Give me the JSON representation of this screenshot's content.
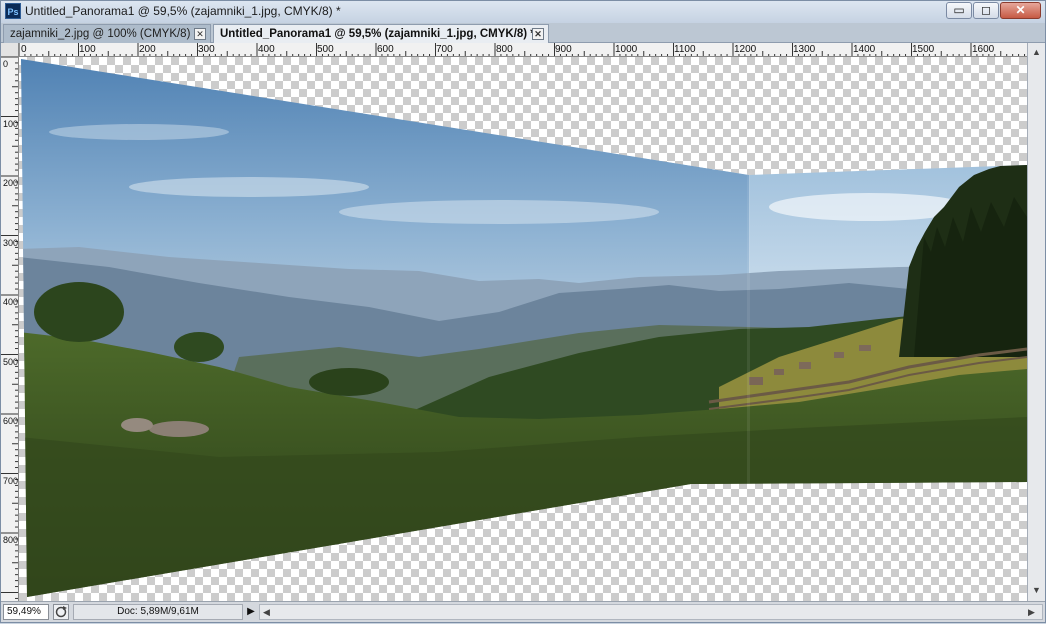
{
  "app": {
    "logo_text": "Ps",
    "window_title": "Untitled_Panorama1 @ 59,5% (zajamniki_1.jpg, CMYK/8) *"
  },
  "window_controls": {
    "minimize_icon": "minimize-icon",
    "maximize_icon": "maximize-icon",
    "close_icon": "close-icon",
    "minimize_glyph": "▭",
    "maximize_glyph": "◻",
    "close_glyph": "✕"
  },
  "tabs": [
    {
      "label": "zajamniki_2.jpg @ 100% (CMYK/8)",
      "close_glyph": "✕",
      "active": false
    },
    {
      "label": "Untitled_Panorama1 @ 59,5% (zajamniki_1.jpg, CMYK/8) *",
      "close_glyph": "✕",
      "active": true
    }
  ],
  "rulers": {
    "horizontal_labels": [
      "0",
      "100",
      "200",
      "300",
      "400",
      "500",
      "600",
      "700",
      "800",
      "900",
      "1000",
      "1100",
      "1200",
      "1300",
      "1400",
      "1500",
      "1600"
    ],
    "vertical_labels": [
      "0",
      "100",
      "200",
      "300",
      "400",
      "500",
      "600",
      "700",
      "800"
    ]
  },
  "status": {
    "zoom": "59,49%",
    "doc_info": "Doc: 5,89M/9,61M",
    "doc_arrow": "▶",
    "scroll_left": "◀",
    "scroll_right": "▶",
    "scroll_up": "▲",
    "scroll_down": "▼"
  },
  "colors": {
    "sky_top": "#5f8fbf",
    "sky_light": "#c8dcec",
    "mountains": "#7d94ab",
    "forest": "#2f4a22",
    "meadow": "#3e5626",
    "meadow_light": "#6f7f33"
  }
}
